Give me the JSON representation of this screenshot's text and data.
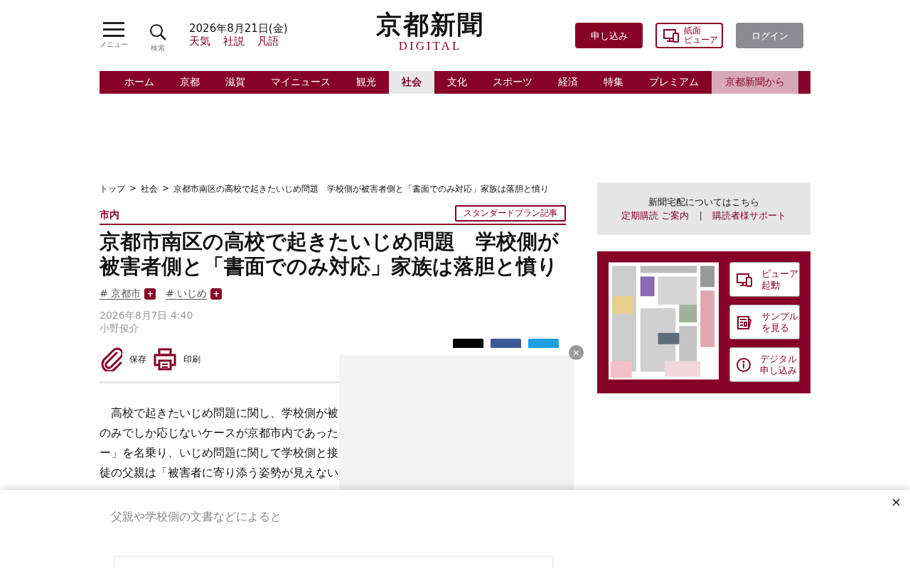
{
  "header": {
    "menu_label": "メニュー",
    "search_label": "検索",
    "date": "2026年8月21日(金)",
    "quick_links": [
      "天気",
      "社説",
      "凡語"
    ],
    "logo": "京都新聞",
    "logo_sub": "DIGITAL",
    "buttons": [
      {
        "kind": "primary",
        "lines": [
          "申し込み"
        ]
      },
      {
        "kind": "viewer",
        "lines": [
          "紙面",
          "ビューア"
        ]
      },
      {
        "kind": "muted",
        "lines": [
          "ログイン"
        ]
      }
    ]
  },
  "nav": [
    {
      "label": "ホーム",
      "selected": false,
      "kind": "normal"
    },
    {
      "label": "京都",
      "selected": false,
      "kind": "normal"
    },
    {
      "label": "滋賀",
      "selected": false,
      "kind": "normal"
    },
    {
      "label": "マイニュース",
      "selected": false,
      "kind": "normal"
    },
    {
      "label": "観光",
      "selected": false,
      "kind": "normal"
    },
    {
      "label": "社会",
      "selected": true,
      "kind": "normal"
    },
    {
      "label": "文化",
      "selected": false,
      "kind": "normal"
    },
    {
      "label": "スポーツ",
      "selected": false,
      "kind": "normal"
    },
    {
      "label": "経済",
      "selected": false,
      "kind": "normal"
    },
    {
      "label": "特集",
      "selected": false,
      "kind": "normal"
    },
    {
      "label": "プレミアム",
      "selected": false,
      "kind": "normal"
    },
    {
      "label": "京都新聞から",
      "selected": false,
      "kind": "special"
    }
  ],
  "breadcrumb": {
    "separator": ">",
    "items": [
      "トップ",
      "社会",
      "京都市南区の高校で起きたいじめ問題　学校側が被害者側と「書面でのみ対応」家族は落胆と憤り"
    ]
  },
  "article": {
    "category": "市内",
    "plan_badge": "スタンダードプラン記事",
    "title": "京都市南区の高校で起きたいじめ問題　学校側が被害者側と「書面でのみ対応」家族は落胆と憤り",
    "tags": [
      {
        "label": "# 京都市",
        "add": "+"
      },
      {
        "label": "# いじめ",
        "add": "+"
      }
    ],
    "date": "2026年8月7日 4:40",
    "author": "小野俊介",
    "tools": [
      {
        "kind": "clip",
        "label": "保存"
      },
      {
        "kind": "print",
        "label": "印刷"
      }
    ],
    "share": [
      {
        "kind": "x"
      },
      {
        "kind": "facebook"
      },
      {
        "kind": "other"
      }
    ],
    "body_lines": [
      "高校で起きたいじめ問題に関し、学校側が被",
      "のみでしか応じないケースが京都市内であった",
      "ー」を名乗り、いじめ問題に関して学校側と接",
      "徒の父親は「被害者に寄り添う姿勢が見えない"
    ],
    "faded_line": "父親や学校側の文書などによると"
  },
  "sidebar": {
    "delivery": {
      "heading": "新聞宅配についてはこちら",
      "links": [
        "定期購読 ご案内",
        "購読者様サポート"
      ],
      "separator": "|"
    },
    "viewer_panel": {
      "buttons": [
        {
          "kind": "viewer",
          "lines": [
            "ビューア",
            "起動"
          ]
        },
        {
          "kind": "sample",
          "lines": [
            "サンプル",
            "を見る"
          ]
        },
        {
          "kind": "info",
          "lines": [
            "デジタル",
            "申し込み"
          ]
        }
      ]
    }
  },
  "ad_overlay": {
    "close": "×"
  },
  "bottom_banner": {
    "close": "×"
  }
}
